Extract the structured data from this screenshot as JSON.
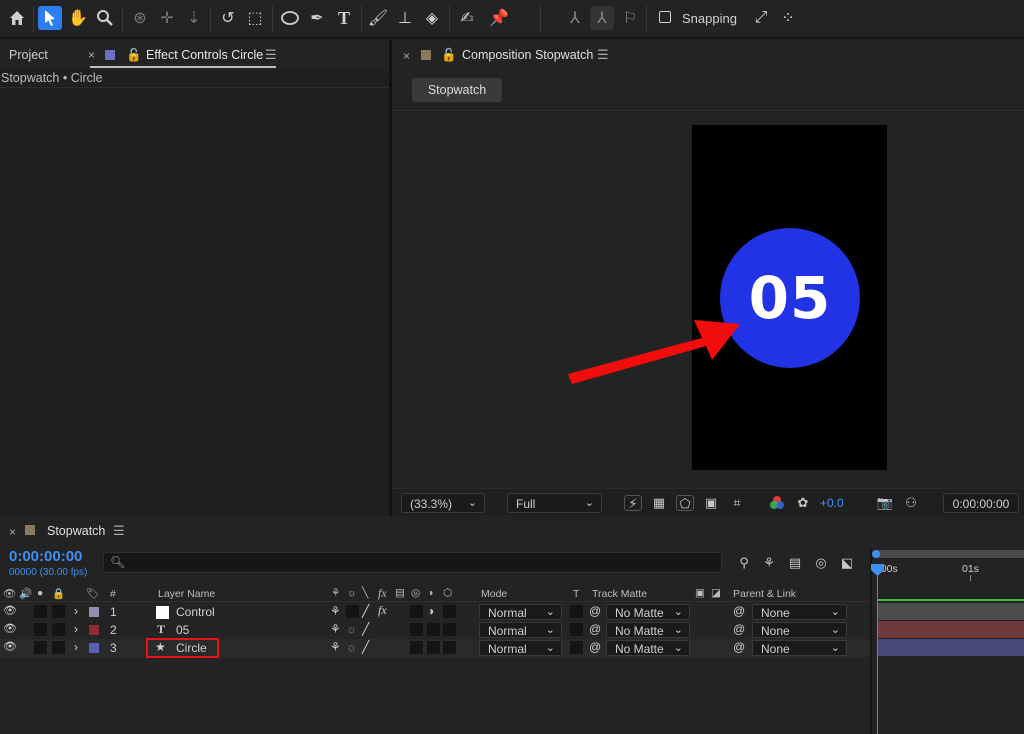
{
  "toolbar": {
    "snapping_label": "Snapping",
    "tools": [
      "home-icon",
      "selection-tool-icon",
      "hand-tool-icon",
      "zoom-tool-icon",
      "orbit-camera-icon",
      "pan-camera-icon",
      "dolly-camera-icon",
      "rotation-tool-icon",
      "pan-behind-icon",
      "ellipse-tool-icon",
      "pen-tool-icon",
      "type-tool-icon",
      "brush-tool-icon",
      "clone-stamp-icon",
      "eraser-icon",
      "roto-brush-icon",
      "puppet-pin-icon"
    ]
  },
  "left_panel": {
    "tab_project": "Project",
    "tab_effect_controls": "Effect Controls Circle",
    "breadcrumb": "Stopwatch • Circle"
  },
  "comp_panel": {
    "tab_title": "Composition Stopwatch",
    "comp_button": "Stopwatch",
    "canvas_text": "05",
    "circle_color": "#2233e6",
    "zoom": "(33.3%)",
    "resolution": "Full",
    "exposure": "+0.0",
    "timecode": "0:00:00:00"
  },
  "timeline": {
    "tab_title": "Stopwatch",
    "timecode": "0:00:00:00",
    "frame_info": "00000 (30.00 fps)",
    "ruler_labels": [
      "0:00s",
      "01s"
    ],
    "columns": {
      "number": "#",
      "layer_name": "Layer Name",
      "mode": "Mode",
      "t": "T",
      "track_matte": "Track Matte",
      "parent_link": "Parent & Link"
    },
    "layers": [
      {
        "index": "1",
        "name": "Control",
        "mode": "Normal",
        "matte": "No Matte",
        "parent": "None",
        "label_color": "#8e8eb0",
        "bar_color": "#4b4b4b"
      },
      {
        "index": "2",
        "name": "05",
        "mode": "Normal",
        "matte": "No Matte",
        "parent": "None",
        "label_color": "#8a2e35",
        "bar_color": "#6e3a3e"
      },
      {
        "index": "3",
        "name": "Circle",
        "mode": "Normal",
        "matte": "No Matte",
        "parent": "None",
        "label_color": "#5a5fb4",
        "bar_color": "#454a78"
      }
    ]
  }
}
